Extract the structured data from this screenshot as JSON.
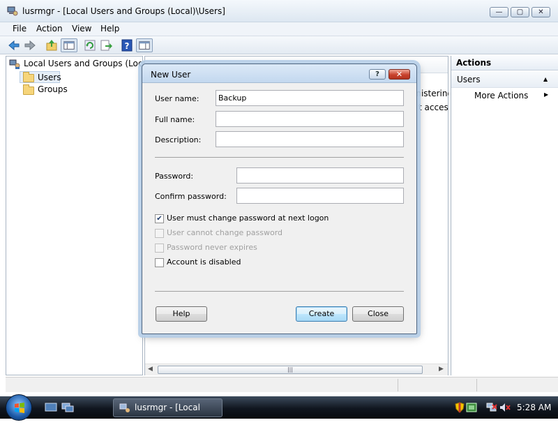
{
  "window": {
    "title": "lusrmgr - [Local Users and Groups (Local)\\Users]",
    "min_glyph": "—",
    "max_glyph": "▢",
    "close_glyph": "✕"
  },
  "menu": [
    "File",
    "Action",
    "View",
    "Help"
  ],
  "toolbar_icons": [
    "back-arrow-icon",
    "forward-arrow-icon",
    "up-folder-icon",
    "show-hide-tree-icon",
    "refresh-icon",
    "export-list-icon",
    "help-icon",
    "show-hide-action-pane-icon"
  ],
  "tree": {
    "root": "Local Users and Groups (Local)",
    "items": [
      "Users",
      "Groups"
    ]
  },
  "list": {
    "visible_fragments": [
      "inistering",
      "t access t"
    ]
  },
  "actions": {
    "header": "Actions",
    "section": "Users",
    "section_arrow": "▲",
    "item": "More Actions",
    "item_arrow": "▶"
  },
  "dialog": {
    "title": "New User",
    "help_glyph": "?",
    "close_glyph": "✕",
    "username_label": "User name:",
    "username_value": "Backup",
    "fullname_label": "Full name:",
    "fullname_value": "",
    "description_label": "Description:",
    "description_value": "",
    "password_label": "Password:",
    "confirm_label": "Confirm password:",
    "checkboxes": [
      {
        "label": "User must change password at next logon",
        "checked": true,
        "enabled": true
      },
      {
        "label": "User cannot change password",
        "checked": false,
        "enabled": false
      },
      {
        "label": "Password never expires",
        "checked": false,
        "enabled": false
      },
      {
        "label": "Account is disabled",
        "checked": false,
        "enabled": true
      }
    ],
    "check_glyph": "✔",
    "help_button": "Help",
    "create_button": "Create",
    "close_button": "Close"
  },
  "scrollbar": {
    "left_arrow": "◀",
    "right_arrow": "▶",
    "grip": "|||"
  },
  "taskbar": {
    "task_label": "lusrmgr - [Local Use...",
    "time": "5:28 AM"
  },
  "colors": {
    "accent": "#1c5aa8",
    "dialog_close": "#c9422d"
  }
}
